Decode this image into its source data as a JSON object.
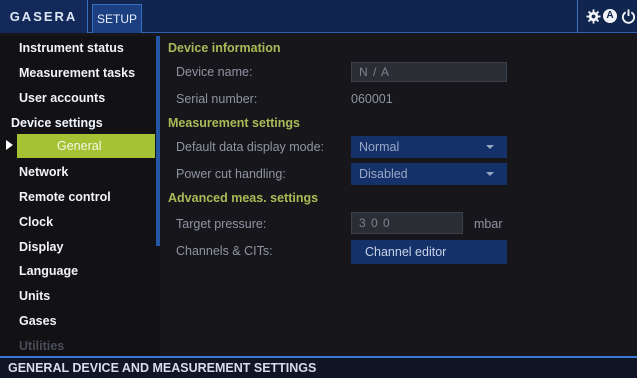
{
  "header": {
    "brand": "GASERA",
    "tab": "SETUP",
    "icons": [
      "gear-icon",
      "a-badge-icon",
      "power-icon"
    ],
    "a_badge": "A"
  },
  "sidebar": {
    "items": [
      {
        "label": "Instrument status"
      },
      {
        "label": "Measurement tasks"
      },
      {
        "label": "User accounts"
      },
      {
        "label": "Device settings"
      },
      {
        "label": "General"
      },
      {
        "label": "Network"
      },
      {
        "label": "Remote control"
      },
      {
        "label": "Clock"
      },
      {
        "label": "Display"
      },
      {
        "label": "Language"
      },
      {
        "label": "Units"
      },
      {
        "label": "Gases"
      },
      {
        "label": "Utilities"
      }
    ]
  },
  "main": {
    "device_info": {
      "title": "Device information",
      "device_name_label": "Device name:",
      "device_name_value": "N / A",
      "serial_label": "Serial number:",
      "serial_value": "060001"
    },
    "measurement": {
      "title": "Measurement settings",
      "display_mode_label": "Default data display mode:",
      "display_mode_value": "Normal",
      "power_cut_label": "Power cut handling:",
      "power_cut_value": "Disabled"
    },
    "advanced": {
      "title": "Advanced meas. settings",
      "target_pressure_label": "Target pressure:",
      "target_pressure_value": "3 0 0",
      "target_pressure_unit": "mbar",
      "channels_label": "Channels & CITs:",
      "channel_editor_button": "Channel editor"
    }
  },
  "status": {
    "text": "GENERAL DEVICE AND MEASUREMENT SETTINGS"
  },
  "colors": {
    "accent": "#a4c233",
    "section_header": "#a9bb57",
    "bar_blue": "#11264f",
    "control_blue": "#15316a"
  }
}
